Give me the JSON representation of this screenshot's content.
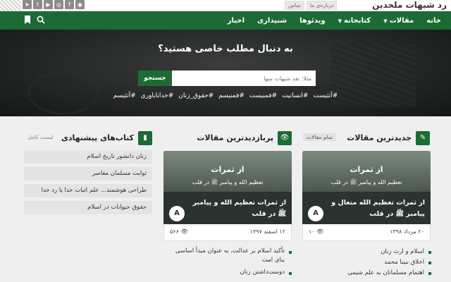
{
  "header": {
    "brand": "رد شبهات ملحدین",
    "top_links": [
      "درباره‌ی ما",
      "تماس"
    ],
    "social_icons": [
      "telegram-icon",
      "twitter-icon",
      "youtube-icon",
      "instagram-icon",
      "facebook-icon",
      "rss-icon"
    ]
  },
  "nav": {
    "items": [
      {
        "label": "خانه"
      },
      {
        "label": "مقالات",
        "dropdown": true
      },
      {
        "label": "کتابخانه",
        "dropdown": true
      },
      {
        "label": "ویدئوها"
      },
      {
        "label": "شنیداری"
      },
      {
        "label": "اخبار"
      }
    ],
    "colors": {
      "primary": "#1d6b34"
    }
  },
  "hero": {
    "title": "به دنبال مطلب خاصی هستید؟",
    "search_placeholder": "مثلا: نقد شبهات سها",
    "search_button": "جستجو",
    "tags": [
      "#آتئیست",
      "#انسانیت",
      "#فمنیست",
      "#فمنیسم",
      "#حقوق_زنان",
      "#خداناباوری",
      "#آتئیسم"
    ]
  },
  "latest": {
    "title": "جدیدترین مقالات",
    "more": "تمام مقالات",
    "card": {
      "overlay_title": "از ثمرات",
      "overlay_sub": "تعظیم الله و پیامبر ﷺ در قلب",
      "title": "از ثمرات تعظیم الله متعال و پیامبر ﷺ در قلب",
      "date": "۲۰ مرداد ۱۳۹۸",
      "views": "۱۰"
    },
    "list": [
      "اسلام و ارث زنان",
      "اخلاق نبینا محمد",
      "اهتمام مسلمانان به علم شیمی"
    ]
  },
  "popular": {
    "title": "پربازدیدترین مقالات",
    "card": {
      "overlay_title": "از ثمرات",
      "overlay_sub": "تعظیم الله و پیامبر ﷺ در قلب",
      "title": "از ثمرات تعظیم الله و پیامبر ﷺ در قلب",
      "date": "۱۲ اسفند ۱۳۹۷",
      "views": "۵۶۶"
    },
    "list": [
      "تأکید اسلام بر عدالت، به عنوان مبدأ اساسی بنای امت",
      "دوست‌داشتن زنان"
    ]
  },
  "books": {
    "title": "کتاب‌های پیشنهادی",
    "more": "لیست کامل",
    "items": [
      "زنان دانشور تاریخ اسلام",
      "ثوابت مسلمان معاصر",
      "طراحی هوشمند... علم اثبات خدا یا رد خدا",
      "حقوق حیوانات در اسلام"
    ]
  }
}
